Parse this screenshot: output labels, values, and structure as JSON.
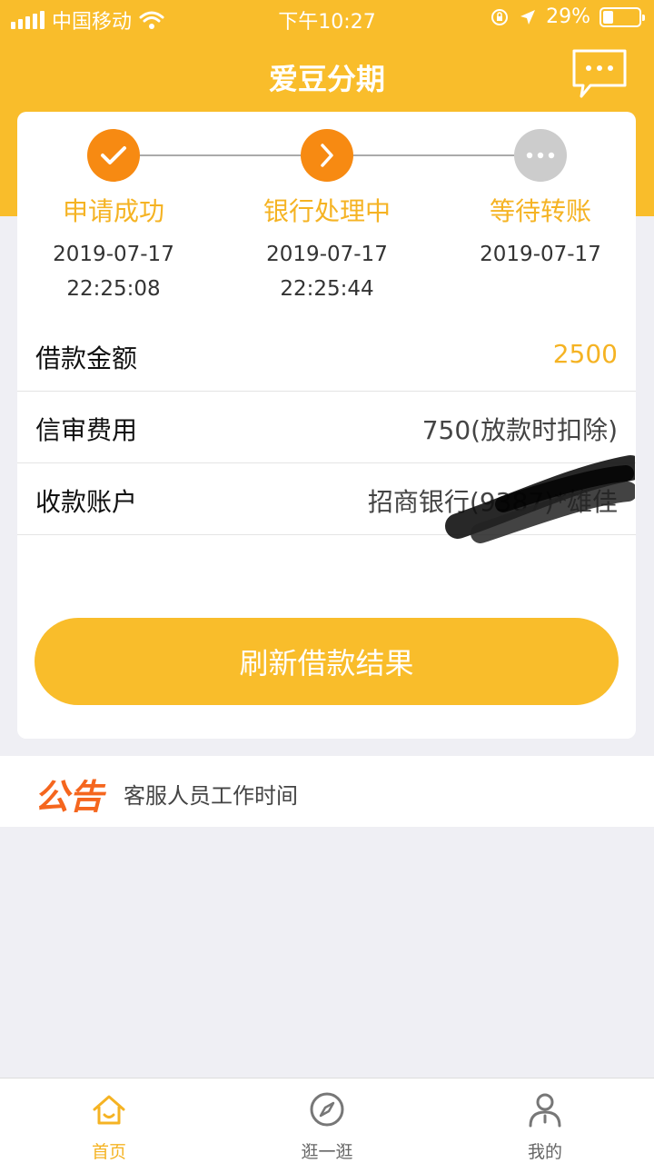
{
  "status_bar": {
    "carrier": "中国移动",
    "time": "下午10:27",
    "battery": "29%"
  },
  "nav": {
    "title": "爱豆分期"
  },
  "steps": [
    {
      "label": "申请成功",
      "date": "2019-07-17",
      "time": "22:25:08",
      "state": "done"
    },
    {
      "label": "银行处理中",
      "date": "2019-07-17",
      "time": "22:25:44",
      "state": "current"
    },
    {
      "label": "等待转账",
      "date": "2019-07-17",
      "time": "",
      "state": "pending"
    }
  ],
  "details": {
    "amount": {
      "label": "借款金额",
      "value": "2500"
    },
    "fee": {
      "label": "信审费用",
      "value": "750(放款时扣除)"
    },
    "account": {
      "label": "收款账户",
      "value": "招商银行(9387)*雄佳"
    }
  },
  "refresh_label": "刷新借款结果",
  "notice": {
    "tag": "公告",
    "text": "客服人员工作时间"
  },
  "tabs": [
    {
      "label": "首页",
      "icon": "home-icon"
    },
    {
      "label": "逛一逛",
      "icon": "compass-icon"
    },
    {
      "label": "我的",
      "icon": "user-icon"
    }
  ],
  "colors": {
    "accent": "#f9bd2b",
    "step_done": "#f78a12",
    "step_pending": "#cccccc",
    "notice_tag": "#f5661e"
  }
}
